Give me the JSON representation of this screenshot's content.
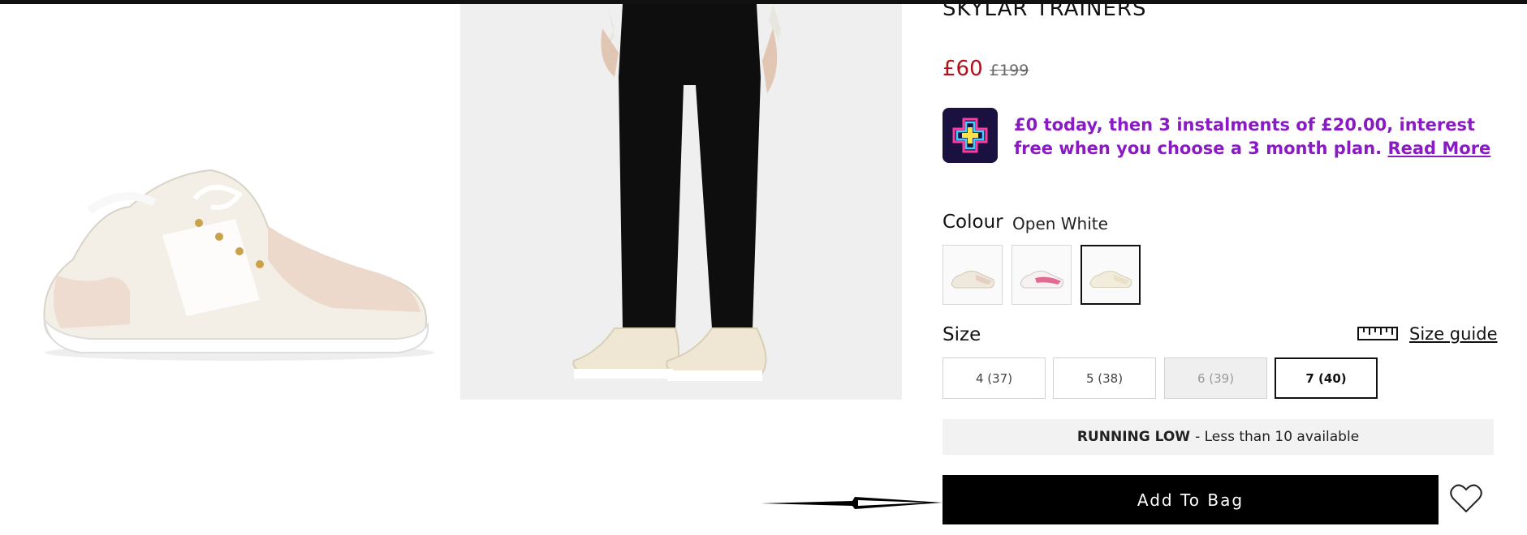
{
  "product": {
    "title": "SKYLAR TRAINERS",
    "price_now": "£60",
    "price_was": "£199"
  },
  "finance": {
    "text": "£0 today, then 3 instalments of £20.00, interest free when you choose a 3 month plan.",
    "link_label": "Read More",
    "icon": "finance-cross-icon"
  },
  "colour": {
    "label": "Colour",
    "value": "Open White",
    "swatch_icons": [
      "white-beige-trainer-swatch",
      "pink-trainer-swatch",
      "open-white-trainer-swatch"
    ]
  },
  "size": {
    "label": "Size",
    "guide_label": "Size guide",
    "options": [
      {
        "label": "4 (37)",
        "state": "available"
      },
      {
        "label": "5 (38)",
        "state": "available"
      },
      {
        "label": "6 (39)",
        "state": "unavailable"
      },
      {
        "label": "7 (40)",
        "state": "selected"
      }
    ]
  },
  "stock": {
    "status": "RUNNING LOW",
    "detail": "- Less than 10 available"
  },
  "actions": {
    "add_to_bag": "Add To Bag"
  },
  "colors": {
    "price": "#b0101a",
    "finance": "#8a1ac4",
    "button": "#000000"
  }
}
